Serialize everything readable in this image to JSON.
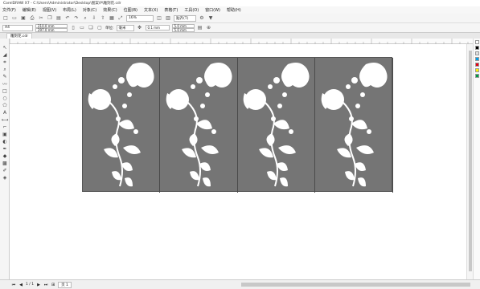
{
  "title": "CorelDRAW X7 - C:\\Users\\Administrator\\Desktop\\图案\\P\\雕刻花.cdr",
  "menu": [
    "文件(F)",
    "编辑(E)",
    "视图(V)",
    "布局(L)",
    "对象(C)",
    "效果(C)",
    "位图(B)",
    "文本(X)",
    "表格(T)",
    "工具(O)",
    "窗口(W)",
    "帮助(H)"
  ],
  "toolbar": {
    "zoom": "16%",
    "snap": "贴齐(T)"
  },
  "propbar": {
    "paper": "A4",
    "width": "210.0 mm",
    "height": "297.0 mm",
    "units_label": "单位:",
    "units": "毫米",
    "nudge": "0.1 mm",
    "dup_x": "5.0 mm",
    "dup_y": "5.0 mm"
  },
  "doc_tab": "雕刻花.cdr",
  "status": {
    "page_count": "1 / 1",
    "page_tab": "页 1"
  },
  "palette": [
    "#ffffff",
    "#000000",
    "#e0e0e0",
    "#00a0e9",
    "#e60012",
    "#fff100",
    "#009944"
  ],
  "colors": {
    "panel_fill": "#757575",
    "flower_fill": "#ffffff"
  },
  "page": {
    "panels": 4
  }
}
